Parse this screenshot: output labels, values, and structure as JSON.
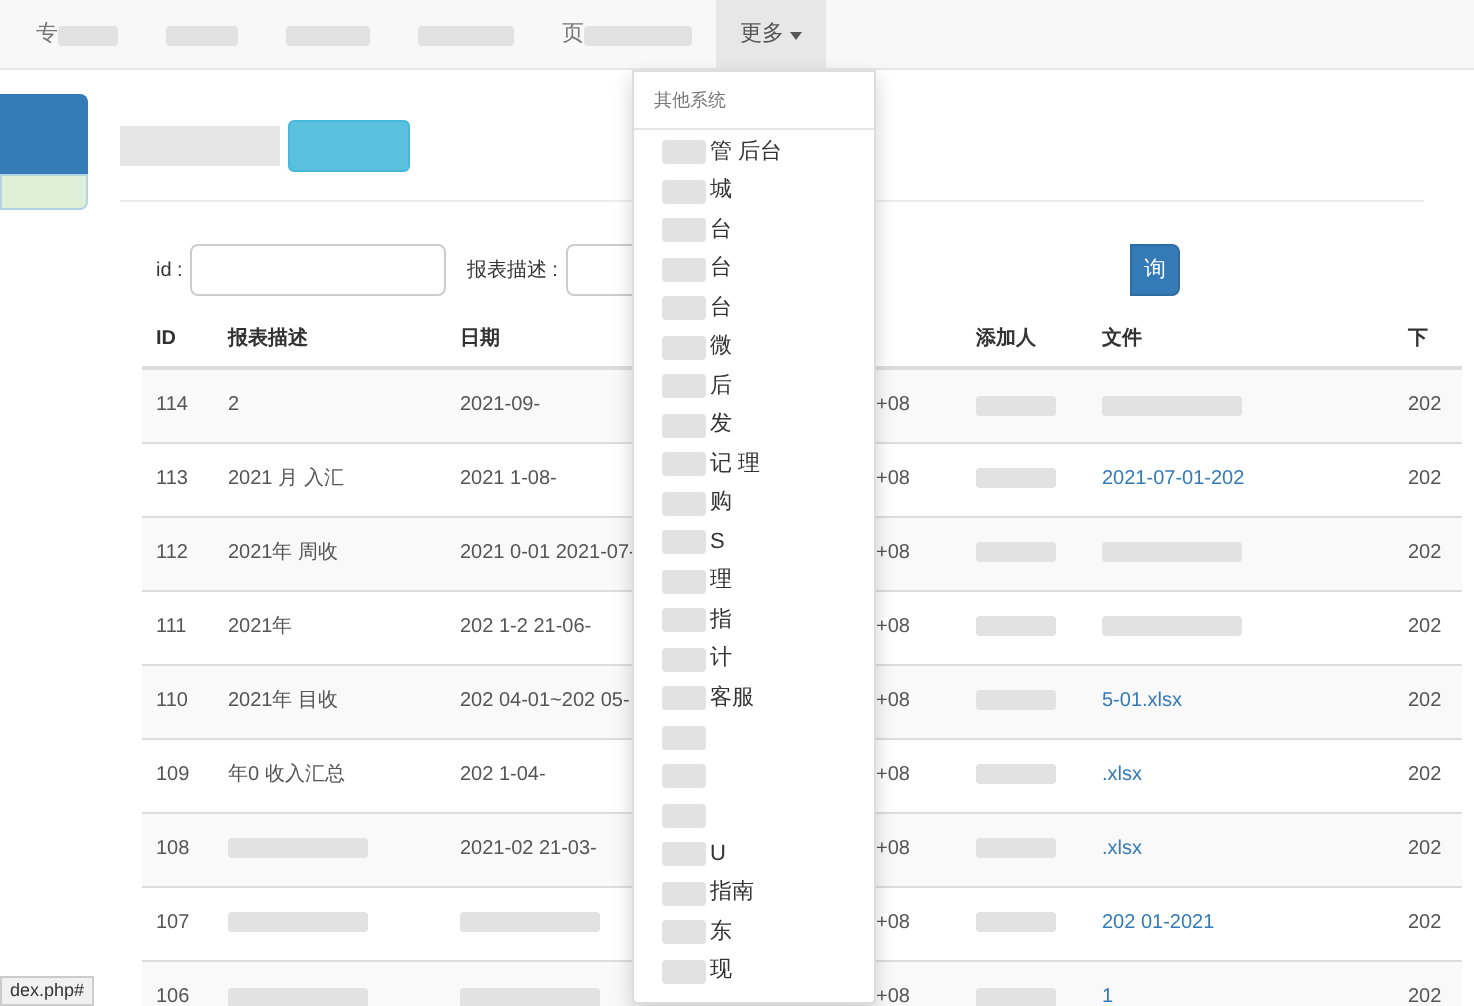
{
  "navbar": {
    "items": [
      {
        "text": "专",
        "redacted": true,
        "selected": false
      },
      {
        "redacted": true,
        "selected": false
      },
      {
        "redacted": true,
        "selected": false
      },
      {
        "redacted": true,
        "selected": false
      },
      {
        "text": "页",
        "redacted": true,
        "selected": false
      },
      {
        "text": "更多",
        "caret": true,
        "redacted": false,
        "selected": true
      }
    ]
  },
  "dropdown": {
    "header": "其他系统",
    "items": [
      {
        "text": "管 后台",
        "redacted": true
      },
      {
        "text": "城",
        "redacted": true
      },
      {
        "text": "台",
        "redacted": true
      },
      {
        "text": "台",
        "redacted": true
      },
      {
        "text": "台",
        "redacted": true
      },
      {
        "text": "微",
        "redacted": true
      },
      {
        "text": "后",
        "redacted": true
      },
      {
        "text": "发",
        "redacted": true
      },
      {
        "text": "记 理",
        "redacted": true
      },
      {
        "text": "购",
        "redacted": true
      },
      {
        "text": "S",
        "redacted": true
      },
      {
        "text": "理",
        "redacted": true
      },
      {
        "text": "指",
        "redacted": true
      },
      {
        "text": "计",
        "redacted": true
      },
      {
        "text": "客服",
        "redacted": true
      },
      {
        "redacted": true
      },
      {
        "redacted": true
      },
      {
        "redacted": true
      },
      {
        "text": "U",
        "redacted": true
      },
      {
        "text": "指南",
        "redacted": true
      },
      {
        "text": "东",
        "redacted": true
      },
      {
        "text": "现",
        "redacted": true
      }
    ]
  },
  "header": {
    "title_redacted": true
  },
  "search": {
    "fields": [
      {
        "label": "id :"
      },
      {
        "label": "报表描述 :"
      }
    ],
    "button": "询"
  },
  "table": {
    "columns": [
      "ID",
      "报表描述",
      "日期",
      "添加人",
      "文件",
      "下"
    ],
    "rows": [
      {
        "id": "114",
        "desc": "2",
        "date": "2021-09-",
        "time": "+08",
        "file": "",
        "download": "202"
      },
      {
        "id": "113",
        "desc": "2021 月 入汇",
        "date": "2021 1-08-",
        "time": "+08",
        "file": "2021-07-01-202",
        "download": "202"
      },
      {
        "id": "112",
        "desc": "2021年 周收",
        "date": "2021 0-01 2021-07-",
        "time": "+08",
        "file": "",
        "download": "202"
      },
      {
        "id": "111",
        "desc": "2021年",
        "date": "202 1-2 21-06-",
        "time": "+08",
        "file": "",
        "download": "202"
      },
      {
        "id": "110",
        "desc": "2021年 目收",
        "date": "202 04-01~202 05-",
        "time": "+08",
        "file": "5-01.xlsx",
        "download": "202"
      },
      {
        "id": "109",
        "desc": "年0 收入汇总",
        "date": "202 1-04-",
        "time": "+08",
        "file": ".xlsx",
        "download": "202"
      },
      {
        "id": "108",
        "desc": "",
        "date": "2021-02 21-03-",
        "time": "+08",
        "file": ".xlsx",
        "download": "202"
      },
      {
        "id": "107",
        "desc": "",
        "date": "",
        "time": "+08",
        "file": "202 01-2021",
        "download": "202"
      },
      {
        "id": "106",
        "desc": "",
        "date": "",
        "time": "+08",
        "file": "1",
        "download": "202"
      }
    ]
  },
  "status_url": "dex.php#"
}
